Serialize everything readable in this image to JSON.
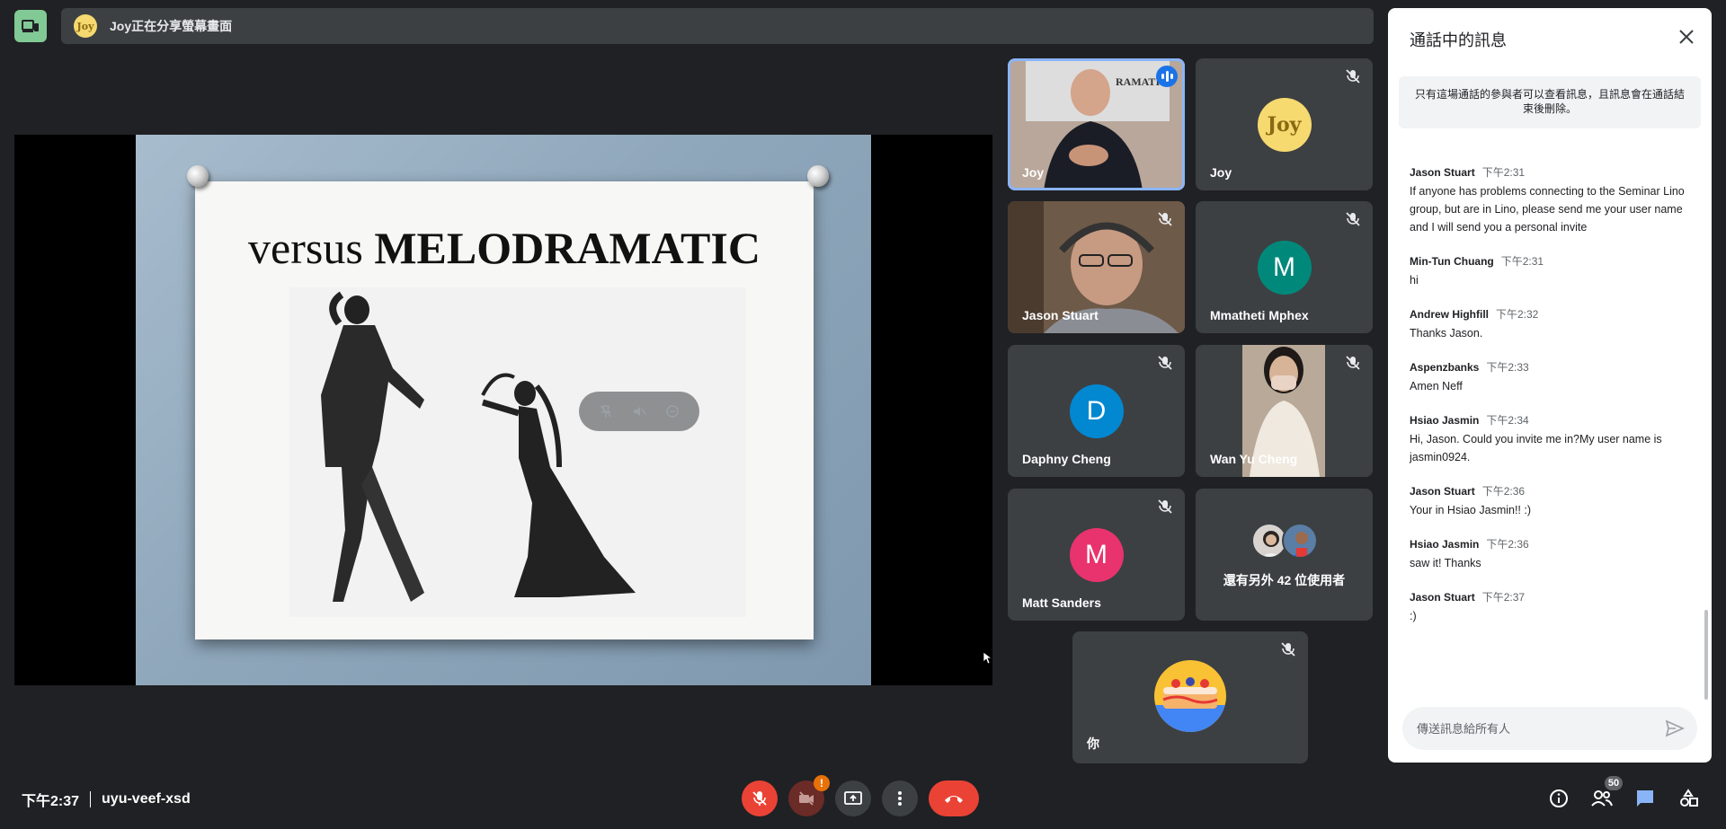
{
  "banner": {
    "presenter_avatar_text": "Joy",
    "text": "Joy正在分享螢幕畫面"
  },
  "slide": {
    "title_light": "versus ",
    "title_bold": "MELODRAMATIC"
  },
  "tiles": [
    {
      "name": "Joy",
      "type": "video",
      "speaking": true
    },
    {
      "name": "Joy",
      "type": "avatar",
      "avatar_text": "Joy",
      "avatar_color": "#f6d96f",
      "muted": true
    },
    {
      "name": "Jason Stuart",
      "type": "video",
      "muted": true
    },
    {
      "name": "Mmatheti Mphex",
      "type": "avatar",
      "avatar_text": "M",
      "avatar_color": "#00897b",
      "muted": true
    },
    {
      "name": "Daphny Cheng",
      "type": "avatar",
      "avatar_text": "D",
      "avatar_color": "#0288d1",
      "muted": true
    },
    {
      "name": "Wan Yu Cheng",
      "type": "video",
      "muted": true
    },
    {
      "name": "Matt Sanders",
      "type": "avatar",
      "avatar_text": "M",
      "avatar_color": "#e8336e",
      "muted": true
    },
    {
      "name": "還有另外 42 位使用者",
      "type": "overflow"
    },
    {
      "name": "你",
      "type": "avatar",
      "avatar_text": "",
      "muted": true
    }
  ],
  "chat": {
    "title": "通話中的訊息",
    "notice": "只有這場通話的參與者可以查看訊息，且訊息會在通話結束後刪除。",
    "input_placeholder": "傳送訊息給所有人",
    "messages": [
      {
        "sender": "Jason Stuart",
        "time": "下午2:31",
        "text": "If anyone has problems connecting to the Seminar Lino group, but are in Lino, please send me your user name and I will send you a personal invite"
      },
      {
        "sender": "Min-Tun Chuang",
        "time": "下午2:31",
        "text": "hi"
      },
      {
        "sender": "Andrew Highfill",
        "time": "下午2:32",
        "text": "Thanks Jason."
      },
      {
        "sender": "Aspenzbanks",
        "time": "下午2:33",
        "text": "Amen Neff"
      },
      {
        "sender": "Hsiao Jasmin",
        "time": "下午2:34",
        "text": "Hi, Jason.  Could you invite me in?My user name is jasmin0924."
      },
      {
        "sender": "Jason Stuart",
        "time": "下午2:36",
        "text": "Your in Hsiao Jasmin!! :)"
      },
      {
        "sender": "Hsiao Jasmin",
        "time": "下午2:36",
        "text": "saw it! Thanks"
      },
      {
        "sender": "Jason Stuart",
        "time": "下午2:37",
        "text": ":)"
      }
    ]
  },
  "bottom": {
    "time": "下午2:37",
    "meeting_code": "uyu-veef-xsd",
    "camera_warning": "!",
    "participant_count": "50"
  },
  "colors": {
    "background": "#202124",
    "tile": "#3c4043",
    "accent_red": "#ea4335",
    "speaking_blue": "#1a73e8",
    "layout_green": "#81c995"
  }
}
